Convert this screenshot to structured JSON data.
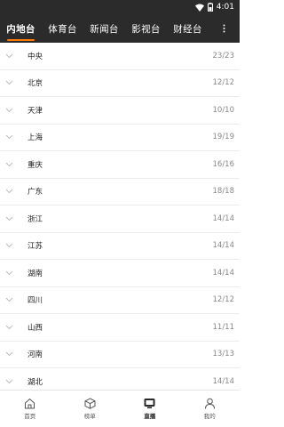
{
  "status_bar": {
    "time": "4:01"
  },
  "tabs": [
    {
      "label": "内地台",
      "active": true
    },
    {
      "label": "体育台",
      "active": false
    },
    {
      "label": "新闻台",
      "active": false
    },
    {
      "label": "影视台",
      "active": false
    },
    {
      "label": "财经台",
      "active": false
    }
  ],
  "channels": [
    {
      "name": "中央",
      "count": "23/23"
    },
    {
      "name": "北京",
      "count": "12/12"
    },
    {
      "name": "天津",
      "count": "10/10"
    },
    {
      "name": "上海",
      "count": "19/19"
    },
    {
      "name": "重庆",
      "count": "16/16"
    },
    {
      "name": "广东",
      "count": "18/18"
    },
    {
      "name": "浙江",
      "count": "14/14"
    },
    {
      "name": "江苏",
      "count": "14/14"
    },
    {
      "name": "湖南",
      "count": "14/14"
    },
    {
      "name": "四川",
      "count": "12/12"
    },
    {
      "name": "山西",
      "count": "11/11"
    },
    {
      "name": "河南",
      "count": "13/13"
    },
    {
      "name": "湖北",
      "count": "14/14"
    }
  ],
  "bottom_nav": [
    {
      "label": "首页",
      "icon": "home-icon",
      "active": false
    },
    {
      "label": "榜单",
      "icon": "cube-icon",
      "active": false
    },
    {
      "label": "直播",
      "icon": "tv-icon",
      "active": true
    },
    {
      "label": "我的",
      "icon": "person-icon",
      "active": false
    }
  ],
  "colors": {
    "header_bg": "#2b2b2b",
    "accent": "#ff7a00"
  }
}
